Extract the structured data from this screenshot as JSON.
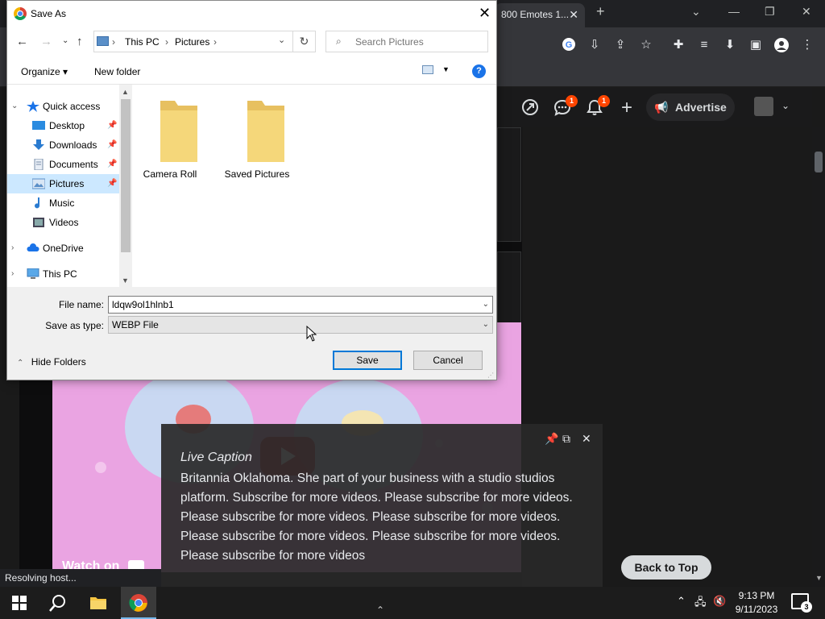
{
  "browser": {
    "tab_title": "800 Emotes 1...",
    "advertise_label": "Advertise",
    "chat_badge": "1",
    "notif_badge": "1",
    "back_to_top": "Back to Top",
    "watch_on": "Watch on",
    "youtube": "YouTube",
    "status_text": "Resolving host..."
  },
  "dialog": {
    "title": "Save As",
    "breadcrumb": [
      "This PC",
      "Pictures"
    ],
    "search_placeholder": "Search Pictures",
    "organize_label": "Organize ▾",
    "new_folder_label": "New folder",
    "help_label": "?",
    "nav": [
      {
        "label": "Quick access",
        "icon": "star-icon"
      },
      {
        "label": "Desktop",
        "icon": "desktop-icon",
        "pinned": true
      },
      {
        "label": "Downloads",
        "icon": "download-icon",
        "pinned": true
      },
      {
        "label": "Documents",
        "icon": "document-icon",
        "pinned": true
      },
      {
        "label": "Pictures",
        "icon": "pictures-icon",
        "pinned": true,
        "selected": true
      },
      {
        "label": "Music",
        "icon": "music-icon"
      },
      {
        "label": "Videos",
        "icon": "video-icon"
      },
      {
        "label": "OneDrive",
        "icon": "cloud-icon"
      },
      {
        "label": "This PC",
        "icon": "computer-icon"
      }
    ],
    "folders": [
      {
        "label": "Camera Roll"
      },
      {
        "label": "Saved Pictures"
      }
    ],
    "file_name_label": "File name:",
    "file_name_value": "ldqw9ol1hlnb1",
    "save_type_label": "Save as type:",
    "save_type_value": "WEBP File",
    "hide_folders_label": "Hide Folders",
    "save_label": "Save",
    "cancel_label": "Cancel"
  },
  "caption": {
    "title": "Live Caption",
    "text": "Britannia Oklahoma. She part of your business with a studio studios platform. Subscribe for more videos. Please subscribe for more videos. Please subscribe for more videos. Please subscribe for more videos. Please subscribe for more videos. Please subscribe for more videos. Please subscribe for more videos"
  },
  "taskbar": {
    "time": "9:13 PM",
    "date": "9/11/2023",
    "notif_count": "3"
  },
  "colors": {
    "accent_blue": "#0078d7",
    "reddit_orange": "#ff4500",
    "folder_yellow": "#f5d77a"
  }
}
